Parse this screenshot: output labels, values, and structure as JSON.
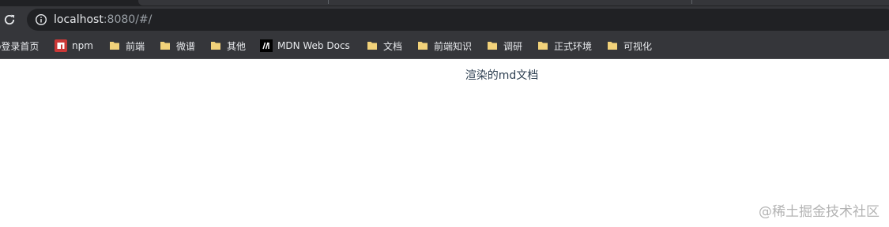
{
  "toolbar": {
    "url_host": "localhost",
    "url_rest": ":8080/#/"
  },
  "bookmarks": [
    {
      "label": "o登录首页",
      "icon": "none"
    },
    {
      "label": "npm",
      "icon": "npm-icon"
    },
    {
      "label": "前端",
      "icon": "folder-icon"
    },
    {
      "label": "微谱",
      "icon": "folder-icon"
    },
    {
      "label": "其他",
      "icon": "folder-icon"
    },
    {
      "label": "MDN Web Docs",
      "icon": "mdn-icon"
    },
    {
      "label": "文档",
      "icon": "folder-icon"
    },
    {
      "label": "前端知识",
      "icon": "folder-icon"
    },
    {
      "label": "调研",
      "icon": "folder-icon"
    },
    {
      "label": "正式环境",
      "icon": "folder-icon"
    },
    {
      "label": "可视化",
      "icon": "folder-icon"
    }
  ],
  "page": {
    "heading": "渲染的md文档"
  },
  "watermark": "@稀土掘金技术社区",
  "colors": {
    "browser_bg": "#35363a",
    "omnibox_bg": "#202124",
    "folder": "#f2d27a",
    "npm_red": "#cb3837",
    "content_text": "#2c3e50"
  }
}
